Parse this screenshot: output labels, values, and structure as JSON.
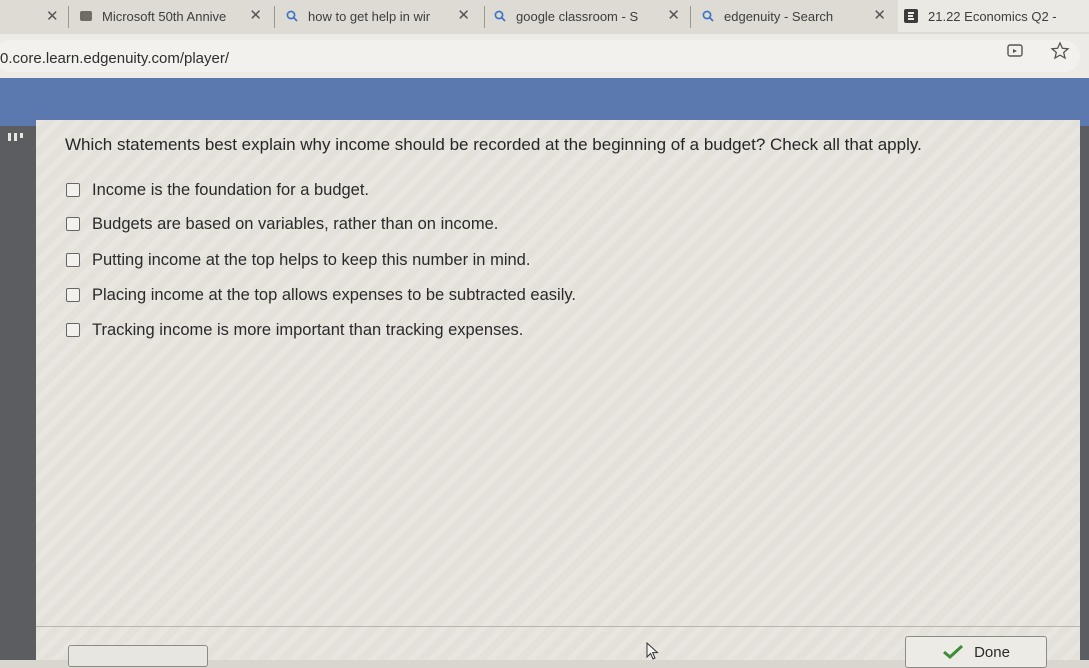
{
  "browser": {
    "tabs": [
      {
        "label": "Microsoft 50th Annive",
        "icon": "microsoft-tab-icon",
        "close": "✕"
      },
      {
        "label": "how to get help in wir",
        "icon": "search-tab-icon",
        "close": "✕"
      },
      {
        "label": "google classroom - S",
        "icon": "search-tab-icon",
        "close": "✕"
      },
      {
        "label": "edgenuity - Search",
        "icon": "search-tab-icon",
        "close": "✕"
      },
      {
        "label": "21.22 Economics Q2 -",
        "icon": "edgenuity-tab-icon",
        "close": ""
      }
    ],
    "leading_close": "✕",
    "url": "0.core.learn.edgenuity.com/player/"
  },
  "colors": {
    "banner": "#5b79ae",
    "player_background": "#5c5d60",
    "panel": "#e4e1da"
  },
  "question": {
    "prompt": "Which statements best explain why income should be recorded at the beginning of a budget? Check all that apply.",
    "options": [
      {
        "label": "Income is the foundation for a budget.",
        "checked": false
      },
      {
        "label": "Budgets are based on variables, rather than on income.",
        "checked": false
      },
      {
        "label": "Putting income at the top helps to keep this number in mind.",
        "checked": false
      },
      {
        "label": "Placing income at the top allows expenses to be subtracted easily.",
        "checked": false
      },
      {
        "label": "Tracking income is more important than tracking expenses.",
        "checked": false
      }
    ]
  },
  "controls": {
    "done_label": "Done"
  }
}
